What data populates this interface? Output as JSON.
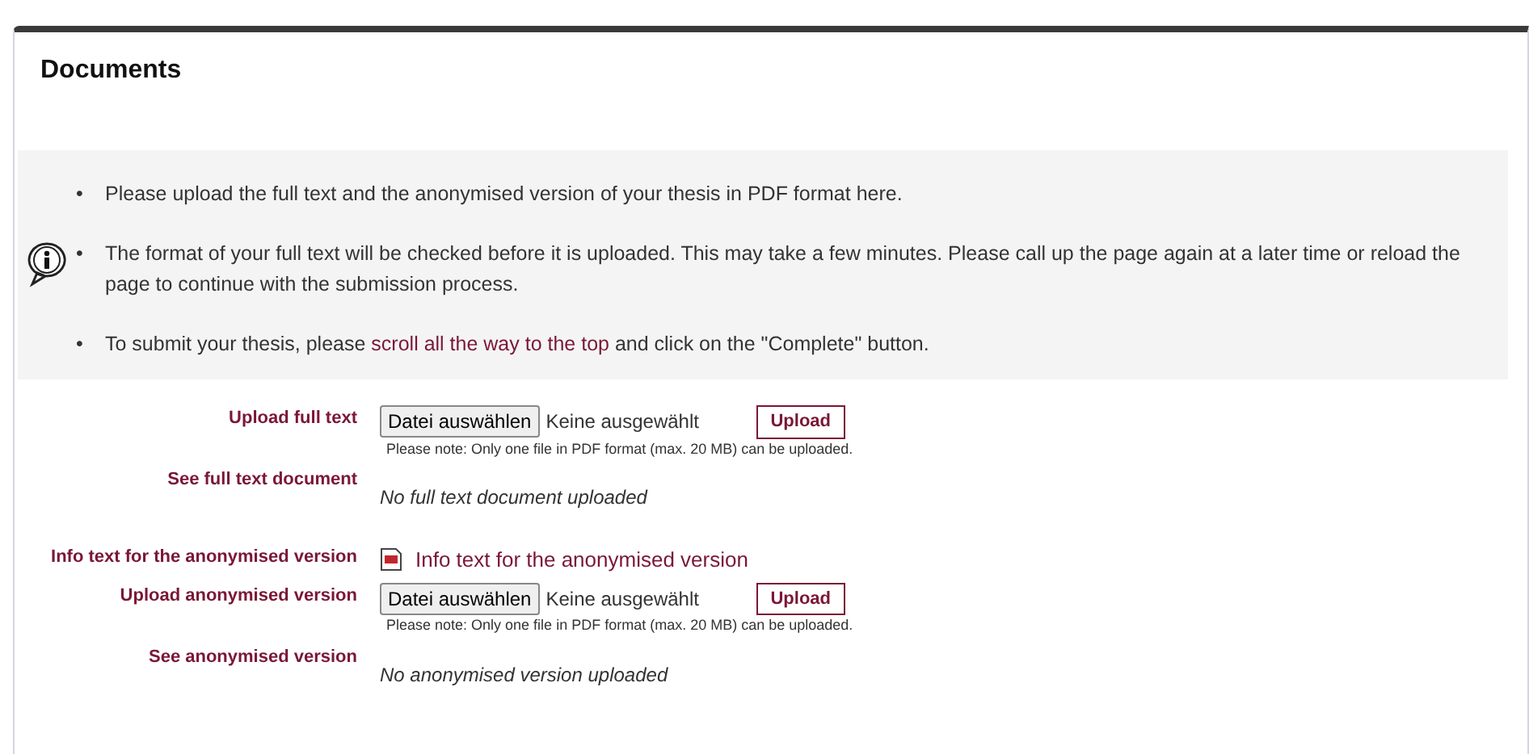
{
  "title": "Documents",
  "bullet": "•",
  "info": [
    {
      "parts": [
        {
          "text": "Please upload the full text and the anonymised version of your thesis in PDF format here.",
          "link": false
        }
      ]
    },
    {
      "parts": [
        {
          "text": "The format of your full text will be checked before it is uploaded. This may take a few minutes. Please call up the page again at a later time or reload the page to continue with the submission process.",
          "link": false
        }
      ]
    },
    {
      "parts": [
        {
          "text": "To submit your thesis, please ",
          "link": false
        },
        {
          "text": "scroll all the way to the top",
          "link": true
        },
        {
          "text": " and click on the \"Complete\" button.",
          "link": false
        }
      ]
    }
  ],
  "groups": [
    [
      {
        "kind": "upload",
        "label": "Upload full text",
        "choose": "Datei auswählen",
        "status": "Keine ausgewählt",
        "button": "Upload",
        "note": "Please note: Only one file in PDF format (max. 20 MB) can be uploaded."
      },
      {
        "kind": "view",
        "label": "See full text document",
        "value": "No full text document uploaded"
      }
    ],
    [
      {
        "kind": "link",
        "label": "Info text for the anonymised version",
        "value": "Info text for the anonymised version"
      },
      {
        "kind": "upload",
        "label": "Upload anonymised version",
        "choose": "Datei auswählen",
        "status": "Keine ausgewählt",
        "button": "Upload",
        "note": "Please note: Only one file in PDF format (max. 20 MB) can be uploaded."
      },
      {
        "kind": "view",
        "label": "See anonymised version",
        "value": "No anonymised version uploaded"
      }
    ]
  ]
}
